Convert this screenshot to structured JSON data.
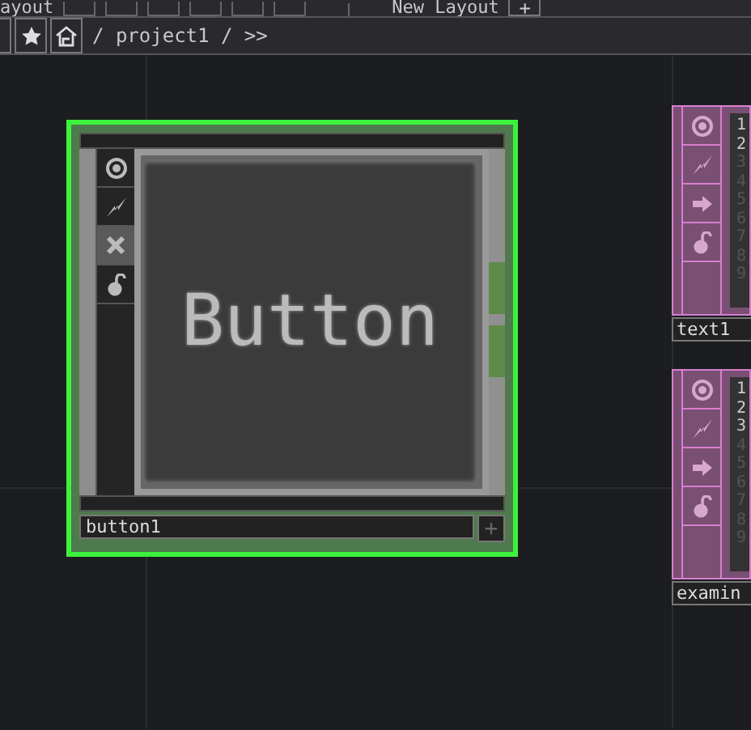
{
  "top_bar": {
    "layout_label": "ayout",
    "new_layout_label": "New Layout",
    "add_button": "+"
  },
  "path_bar": {
    "path": "/ project1 / >>"
  },
  "nodes": [
    {
      "kind": "button",
      "name": "button1",
      "selected": true,
      "viewer_text": "Button",
      "flags": [
        {
          "kind": "viewer"
        },
        {
          "kind": "cook"
        },
        {
          "kind": "bypass"
        },
        {
          "kind": "lock"
        }
      ],
      "add_button": "+"
    },
    {
      "kind": "text",
      "name": "text1",
      "selected": false,
      "flags": [
        {
          "kind": "viewer"
        },
        {
          "kind": "cook"
        },
        {
          "kind": "export"
        },
        {
          "kind": "lock"
        }
      ],
      "lines": [
        {
          "text": "1",
          "faded": false
        },
        {
          "text": "2",
          "faded": false
        },
        {
          "text": "3",
          "faded": true
        },
        {
          "text": "4",
          "faded": true
        },
        {
          "text": "5",
          "faded": true
        },
        {
          "text": "6",
          "faded": true
        },
        {
          "text": "7",
          "faded": true
        },
        {
          "text": "8",
          "faded": true
        },
        {
          "text": "9",
          "faded": true
        }
      ]
    },
    {
      "kind": "text",
      "name": "examin",
      "selected": false,
      "flags": [
        {
          "kind": "viewer"
        },
        {
          "kind": "cook"
        },
        {
          "kind": "export"
        },
        {
          "kind": "lock"
        }
      ],
      "lines": [
        {
          "text": "1",
          "faded": false
        },
        {
          "text": "2",
          "faded": false
        },
        {
          "text": "3",
          "faded": false
        },
        {
          "text": "4",
          "faded": true
        },
        {
          "text": "5",
          "faded": true
        },
        {
          "text": "6",
          "faded": true
        },
        {
          "text": "7",
          "faded": true
        },
        {
          "text": "8",
          "faded": true
        },
        {
          "text": "9",
          "faded": true
        }
      ]
    }
  ]
}
